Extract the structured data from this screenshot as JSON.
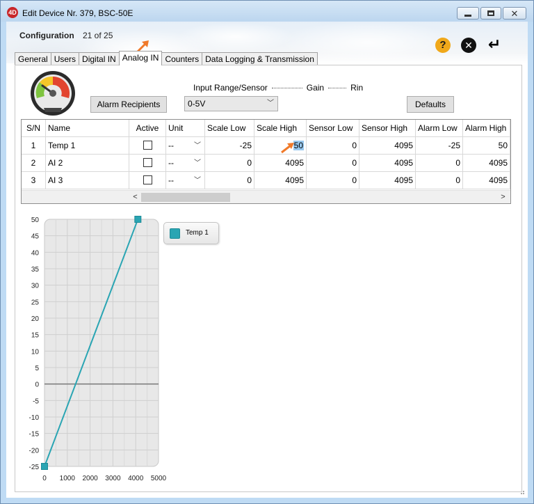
{
  "window": {
    "title": "Edit Device Nr. 379, BSC-50E",
    "app_icon_text": "4D"
  },
  "header": {
    "config_label": "Configuration",
    "config_count": "21 of 25",
    "help_icon": "help-icon",
    "cancel_icon": "cancel-icon",
    "enter_icon": "enter-icon"
  },
  "tabs": [
    {
      "label": "General",
      "active": false
    },
    {
      "label": "Users",
      "active": false
    },
    {
      "label": "Digital IN",
      "active": false
    },
    {
      "label": "Analog IN",
      "active": true
    },
    {
      "label": "Counters",
      "active": false
    },
    {
      "label": "Data Logging & Transmission",
      "active": false
    }
  ],
  "panel": {
    "alarm_recipients": "Alarm Recipients",
    "defaults": "Defaults",
    "range_sensor_label": "Input Range/Sensor",
    "gain_label": "Gain",
    "rin_label": "Rin",
    "input_range_value": "0-5V"
  },
  "table": {
    "columns": [
      "S/N",
      "Name",
      "Active",
      "Unit",
      "Scale Low",
      "Scale High",
      "Sensor Low",
      "Sensor High",
      "Alarm Low",
      "Alarm High"
    ],
    "rows": [
      {
        "sn": "1",
        "name": "Temp 1",
        "active": false,
        "unit": "--",
        "scale_low": "-25",
        "scale_high": "50",
        "sensor_low": "0",
        "sensor_high": "4095",
        "alarm_low": "-25",
        "alarm_high": "50"
      },
      {
        "sn": "2",
        "name": "AI 2",
        "active": false,
        "unit": "--",
        "scale_low": "0",
        "scale_high": "4095",
        "sensor_low": "0",
        "sensor_high": "4095",
        "alarm_low": "0",
        "alarm_high": "4095"
      },
      {
        "sn": "3",
        "name": "AI 3",
        "active": false,
        "unit": "--",
        "scale_low": "0",
        "scale_high": "4095",
        "sensor_low": "0",
        "sensor_high": "4095",
        "alarm_low": "0",
        "alarm_high": "4095"
      }
    ]
  },
  "chart_data": {
    "type": "line",
    "x_ticks": [
      "0",
      "1000",
      "2000",
      "3000",
      "4000",
      "5000"
    ],
    "y_ticks": [
      "50",
      "45",
      "40",
      "35",
      "30",
      "25",
      "20",
      "15",
      "10",
      "5",
      "0",
      "-5",
      "-10",
      "-15",
      "-20",
      "-25"
    ],
    "xlim": [
      0,
      5000
    ],
    "ylim": [
      -25,
      50
    ],
    "grid": true,
    "legend_position": "top-right",
    "series": [
      {
        "name": "Temp 1",
        "color": "#2aa5b3",
        "points": [
          {
            "x": 0,
            "y": -25
          },
          {
            "x": 4095,
            "y": 50
          }
        ]
      }
    ]
  },
  "colors": {
    "accent": "#2aa5b3",
    "arrow": "#f07a2a",
    "help": "#f0a81a"
  }
}
